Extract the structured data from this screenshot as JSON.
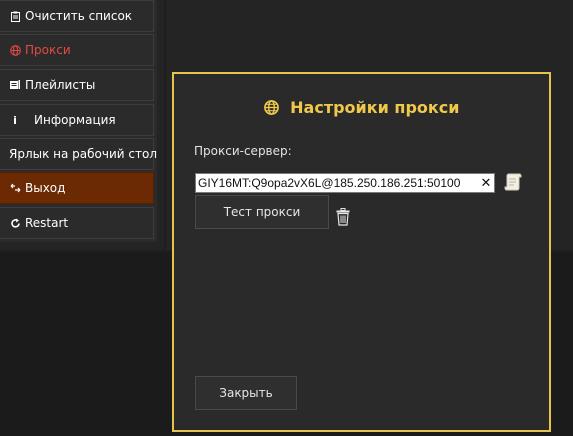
{
  "menu": {
    "items": [
      {
        "label": "Очистить список",
        "icon": "clipboard-icon"
      },
      {
        "label": "Прокси",
        "icon": "globe-icon",
        "active": true
      },
      {
        "label": "Плейлисты",
        "icon": "playlist-icon"
      },
      {
        "label": "Информация",
        "icon": "info-icon"
      },
      {
        "label": "Ярлык на рабочий стол",
        "icon": ""
      },
      {
        "label": "Выход",
        "icon": "exit-icon"
      },
      {
        "label": "Restart",
        "icon": "restart-icon"
      }
    ]
  },
  "dialog": {
    "title": "Настройки прокси",
    "proxy_label": "Прокси-сервер:",
    "proxy_value": "GIY16MT:Q9opa2vX6L@185.250.186.251:50100",
    "test_button": "Тест прокси",
    "close_button": "Закрыть"
  },
  "colors": {
    "accent": "#f0c94b",
    "active_menu": "#e14b45",
    "exit_bg": "#6b2a04"
  }
}
